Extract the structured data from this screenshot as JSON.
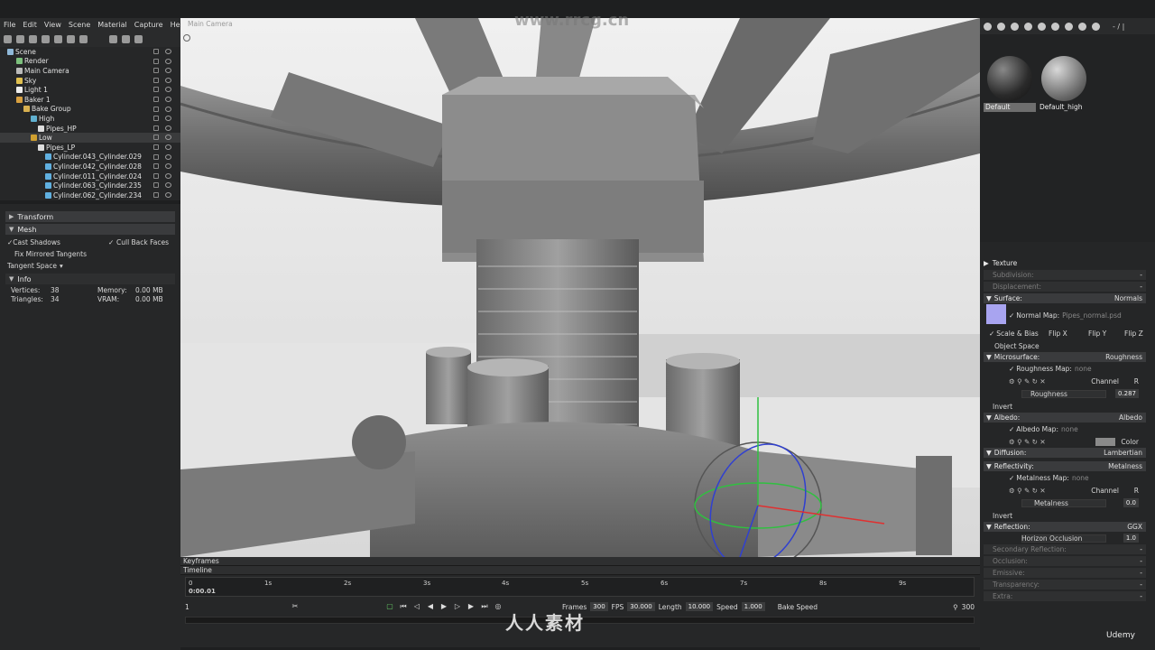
{
  "menubar": {
    "items": [
      "File",
      "Edit",
      "View",
      "Scene",
      "Material",
      "Capture",
      "Help"
    ]
  },
  "scene_tree": {
    "items": [
      {
        "label": "Scene",
        "icon": "scene-icon",
        "color": "#8fb8d8"
      },
      {
        "label": "Render",
        "icon": "render-icon",
        "color": "#7cc07c"
      },
      {
        "label": "Main Camera",
        "icon": "camera-icon",
        "color": "#bbbbbb"
      },
      {
        "label": "Sky",
        "icon": "sky-icon",
        "color": "#e0c050"
      },
      {
        "label": "Light 1",
        "icon": "light-icon",
        "color": "#eeeeee"
      },
      {
        "label": "Baker 1",
        "icon": "baker-icon",
        "color": "#d8a040"
      },
      {
        "label": "Bake Group",
        "icon": "folder-icon",
        "color": "#d8b050"
      },
      {
        "label": "High",
        "icon": "high-icon",
        "color": "#60b0d0"
      },
      {
        "label": "Pipes_HP",
        "icon": "mesh-icon",
        "color": "#dddddd"
      },
      {
        "label": "Low",
        "icon": "low-icon",
        "color": "#d0a030"
      },
      {
        "label": "Pipes_LP",
        "icon": "mesh-icon",
        "color": "#dddddd"
      },
      {
        "label": "Cylinder.043_Cylinder.029",
        "icon": "submesh-icon",
        "color": "#60b0e0"
      },
      {
        "label": "Cylinder.042_Cylinder.028",
        "icon": "submesh-icon",
        "color": "#60b0e0"
      },
      {
        "label": "Cylinder.011_Cylinder.024",
        "icon": "submesh-icon",
        "color": "#60b0e0"
      },
      {
        "label": "Cylinder.063_Cylinder.235",
        "icon": "submesh-icon",
        "color": "#60b0e0"
      },
      {
        "label": "Cylinder.062_Cylinder.234",
        "icon": "submesh-icon",
        "color": "#60b0e0"
      }
    ]
  },
  "left_panel": {
    "transform": "Transform",
    "mesh": "Mesh",
    "cast_shadows": "Cast Shadows",
    "cull_back_faces": "Cull Back Faces",
    "fix_mirrored": "Fix Mirrored Tangents",
    "tangent_space": "Tangent Space",
    "info": "Info",
    "vertices_label": "Vertices:",
    "vertices": "38",
    "triangles_label": "Triangles:",
    "triangles": "34",
    "memory_label": "Memory:",
    "memory": "0.00 MB",
    "vram_label": "VRAM:",
    "vram": "0.00 MB"
  },
  "viewport": {
    "tab": "Main Camera",
    "watermark_top": "www.rrcg.cn"
  },
  "timeline": {
    "keyframes": "Keyframes",
    "timeline": "Timeline",
    "current_time": "0:00.01",
    "ticks": [
      "0",
      "1s",
      "2s",
      "3s",
      "4s",
      "5s",
      "6s",
      "7s",
      "8s",
      "9s"
    ],
    "frame": "1",
    "frames_label": "Frames",
    "frames": "300",
    "fps_label": "FPS",
    "fps": "30.000",
    "length_label": "Length",
    "length": "10.000",
    "speed_label": "Speed",
    "speed": "1.000",
    "bake_speed": "Bake Speed",
    "end_frame": "300"
  },
  "materials": {
    "items": [
      "Default",
      "Default_high"
    ],
    "zoom": "- / |"
  },
  "right_panel": {
    "texture": "Texture",
    "subdivision": "Subdivision:",
    "displacement": "Displacement:",
    "surface": "Surface:",
    "surface_value": "Normals",
    "normal_map": "Normal Map:",
    "normal_map_value": "Pipes_normal.psd",
    "scale_bias": "Scale & Bias",
    "flip_x": "Flip X",
    "flip_y": "Flip Y",
    "flip_z": "Flip Z",
    "object_space": "Object Space",
    "microsurface": "Microsurface:",
    "microsurface_value": "Roughness",
    "roughness_map": "Roughness Map:",
    "roughness_map_value": "none",
    "channel": "Channel",
    "channel_r": "R",
    "roughness": "Roughness",
    "roughness_value": "0.287",
    "invert": "Invert",
    "albedo": "Albedo:",
    "albedo_value": "Albedo",
    "albedo_map": "Albedo Map:",
    "albedo_map_value": "none",
    "color": "Color",
    "diffusion": "Diffusion:",
    "diffusion_value": "Lambertian",
    "reflectivity": "Reflectivity:",
    "reflectivity_value": "Metalness",
    "metalness_map": "Metalness Map:",
    "metalness_map_value": "none",
    "metalness": "Metalness",
    "metalness_value": "0.0",
    "reflection": "Reflection:",
    "reflection_value": "GGX",
    "horizon_occlusion": "Horizon Occlusion",
    "horizon_value": "1.0",
    "secondary_reflection": "Secondary Reflection:",
    "occlusion": "Occlusion:",
    "emissive": "Emissive:",
    "transparency": "Transparency:",
    "extra": "Extra:"
  },
  "footer": {
    "udemy": "Udemy",
    "watermark": "人人素材"
  }
}
